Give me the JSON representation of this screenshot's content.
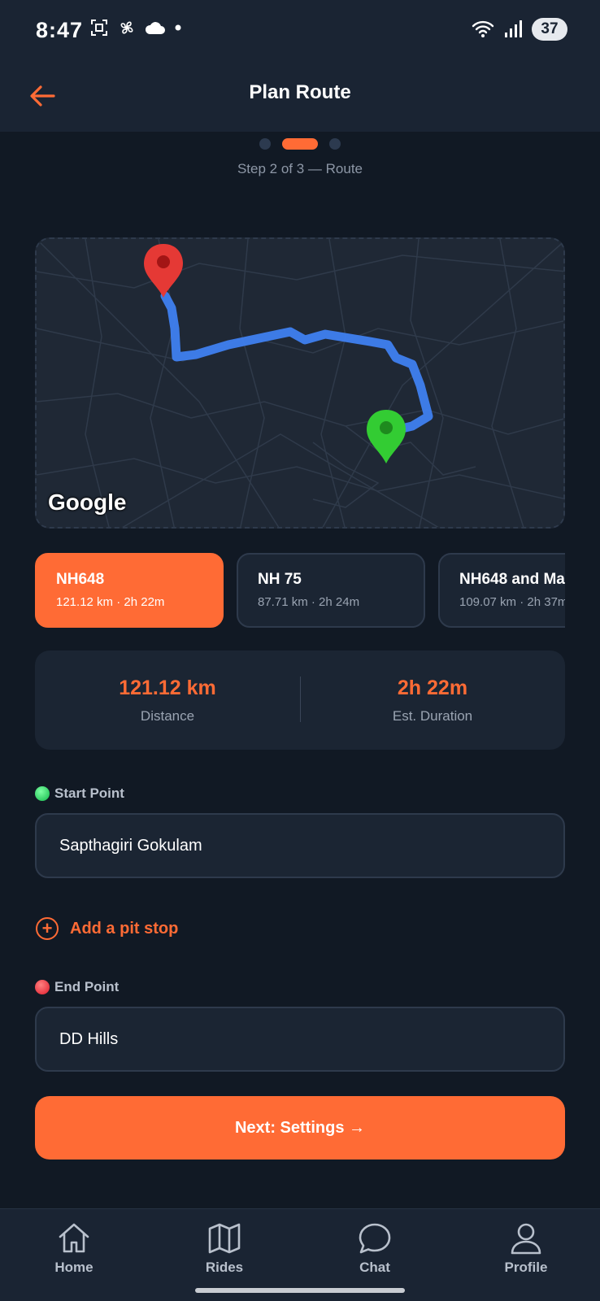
{
  "status_bar": {
    "time": "8:47",
    "battery": "37",
    "icons_left": [
      "screenshot-icon",
      "fan-icon",
      "cloud-icon",
      "dot-icon"
    ],
    "icons_right": [
      "wifi-icon",
      "signal-icon",
      "battery-icon"
    ]
  },
  "header": {
    "title": "Plan Route",
    "back_icon": "arrow-left-icon",
    "accent_color": "#ff6b35"
  },
  "stepper": {
    "current_step": 2,
    "total_steps": 3,
    "text": "Step 2 of 3 — Route"
  },
  "map": {
    "attribution": "Google",
    "start_marker_color": "#33cc33",
    "end_marker_color": "#e53935",
    "route_color": "#3f7ff0"
  },
  "routes": [
    {
      "name": "NH648",
      "meta": "121.12 km · 2h 22m",
      "selected": true
    },
    {
      "name": "NH 75",
      "meta": "87.71 km · 2h 24m",
      "selected": false
    },
    {
      "name": "NH648 and Ma",
      "meta": "109.07 km · 2h 37m",
      "selected": false
    }
  ],
  "stats": {
    "distance_value": "121.12 km",
    "distance_label": "Distance",
    "duration_value": "2h 22m",
    "duration_label": "Est. Duration"
  },
  "start": {
    "label": "Start Point",
    "value": "Sapthagiri Gokulam"
  },
  "pit_stop": {
    "label": "Add a pit stop"
  },
  "end": {
    "label": "End Point",
    "value": "DD Hills"
  },
  "next_button": {
    "label": "Next: Settings →"
  },
  "bottom_nav": [
    {
      "label": "Home",
      "icon": "home-icon"
    },
    {
      "label": "Rides",
      "icon": "map-icon"
    },
    {
      "label": "Chat",
      "icon": "chat-icon"
    },
    {
      "label": "Profile",
      "icon": "user-icon"
    }
  ]
}
